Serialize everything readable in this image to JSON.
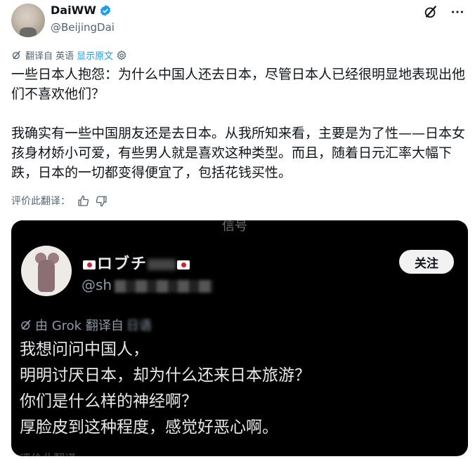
{
  "author": {
    "display_name": "DaiWW",
    "handle": "@BeijingDai",
    "verified_icon": "verified-badge-icon",
    "verified_color": "#1d9bf0"
  },
  "header_actions": {
    "grok_icon": "grok-icon",
    "more_icon": "more-icon"
  },
  "translation": {
    "translated_from": "翻译自 英语",
    "show_original": "显示原文",
    "settings_icon": "gear-icon"
  },
  "tweet": {
    "paragraph_1": "一些日本人抱怨：为什么中国人还去日本，尽管日本人已经很明显地表现出他们不喜欢他们？",
    "paragraph_2": "我确实有一些中国朋友还是去日本。从我所知来看，主要是为了性——日本女孩身材娇小可爱，有些男人就是喜欢这种类型。而且，随着日元汇率大幅下跌，日本的一切都变得便宜了，包括花钱买性。"
  },
  "rate": {
    "label": "评价此翻译：",
    "like_icon": "thumbs-up-icon",
    "dislike_icon": "thumbs-down-icon"
  },
  "media": {
    "top_fragment": "信号",
    "name_visible": "ロブチ",
    "handle_visible": "@sh",
    "follow_label": "关注",
    "grok_line": "由 Grok 翻译自",
    "grok_trailing": "日语",
    "lines": [
      "我想问问中国人，",
      "明明讨厌日本，却为什么还来日本旅游？",
      "你们是什么样的神经啊？",
      "厚脸皮到这种程度，感觉好恶心啊。"
    ],
    "bottom_fragment": "评价此翻译"
  },
  "colors": {
    "accent": "#1d9bf0",
    "text": "#0f1419",
    "muted": "#536471",
    "media_bg": "#000000"
  }
}
